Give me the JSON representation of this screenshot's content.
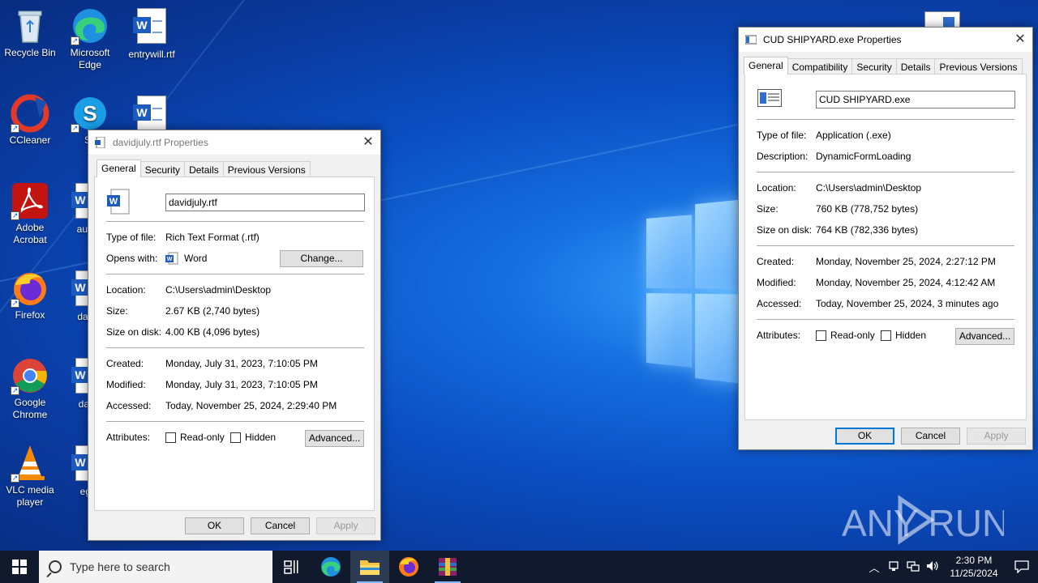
{
  "desktop": {
    "icons": [
      {
        "label": "Recycle Bin",
        "icon": "recycle-bin-icon"
      },
      {
        "label": "Microsoft Edge",
        "icon": "edge-icon"
      },
      {
        "label": "entrywill.rtf",
        "icon": "word-document-icon"
      },
      {
        "label": "CCleaner",
        "icon": "ccleaner-icon"
      },
      {
        "label": "Sk",
        "icon": "skype-icon"
      },
      {
        "label": "Adobe Acrobat",
        "icon": "acrobat-icon"
      },
      {
        "label": "augus",
        "icon": "word-document-icon"
      },
      {
        "label": "Firefox",
        "icon": "firefox-icon"
      },
      {
        "label": "dailye",
        "icon": "file-icon"
      },
      {
        "label": "Google Chrome",
        "icon": "chrome-icon"
      },
      {
        "label": "david",
        "icon": "word-document-icon"
      },
      {
        "label": "VLC media player",
        "icon": "vlc-icon"
      },
      {
        "label": "egliv",
        "icon": "word-document-icon"
      }
    ],
    "watermark": "ANY RUN"
  },
  "rtf_dialog": {
    "title": "davidjuly.rtf Properties",
    "tabs": [
      "General",
      "Security",
      "Details",
      "Previous Versions"
    ],
    "filename": "davidjuly.rtf",
    "type_label": "Type of file:",
    "type_value": "Rich Text Format (.rtf)",
    "opens_label": "Opens with:",
    "opens_value": "Word",
    "change_label": "Change...",
    "location_label": "Location:",
    "location_value": "C:\\Users\\admin\\Desktop",
    "size_label": "Size:",
    "size_value": "2.67 KB (2,740 bytes)",
    "disk_label": "Size on disk:",
    "disk_value": "4.00 KB (4,096 bytes)",
    "created_label": "Created:",
    "created_value": "Monday, July 31, 2023, 7:10:05 PM",
    "modified_label": "Modified:",
    "modified_value": "Monday, July 31, 2023, 7:10:05 PM",
    "accessed_label": "Accessed:",
    "accessed_value": "Today, November 25, 2024, 2:29:40 PM",
    "attributes_label": "Attributes:",
    "readonly_label": "Read-only",
    "hidden_label": "Hidden",
    "advanced_label": "Advanced...",
    "ok_label": "OK",
    "cancel_label": "Cancel",
    "apply_label": "Apply"
  },
  "exe_dialog": {
    "title": "CUD SHIPYARD.exe Properties",
    "tabs": [
      "General",
      "Compatibility",
      "Security",
      "Details",
      "Previous Versions"
    ],
    "filename": "CUD SHIPYARD.exe",
    "type_label": "Type of file:",
    "type_value": "Application (.exe)",
    "desc_label": "Description:",
    "desc_value": "DynamicFormLoading",
    "location_label": "Location:",
    "location_value": "C:\\Users\\admin\\Desktop",
    "size_label": "Size:",
    "size_value": "760 KB (778,752 bytes)",
    "disk_label": "Size on disk:",
    "disk_value": "764 KB (782,336 bytes)",
    "created_label": "Created:",
    "created_value": "Monday, November 25, 2024, 2:27:12 PM",
    "modified_label": "Modified:",
    "modified_value": "Monday, November 25, 2024, 4:12:42 AM",
    "accessed_label": "Accessed:",
    "accessed_value": "Today, November 25, 2024, 3 minutes ago",
    "attributes_label": "Attributes:",
    "readonly_label": "Read-only",
    "hidden_label": "Hidden",
    "advanced_label": "Advanced...",
    "ok_label": "OK",
    "cancel_label": "Cancel",
    "apply_label": "Apply"
  },
  "taskbar": {
    "search_placeholder": "Type here to search",
    "time": "2:30 PM",
    "date": "11/25/2024"
  }
}
